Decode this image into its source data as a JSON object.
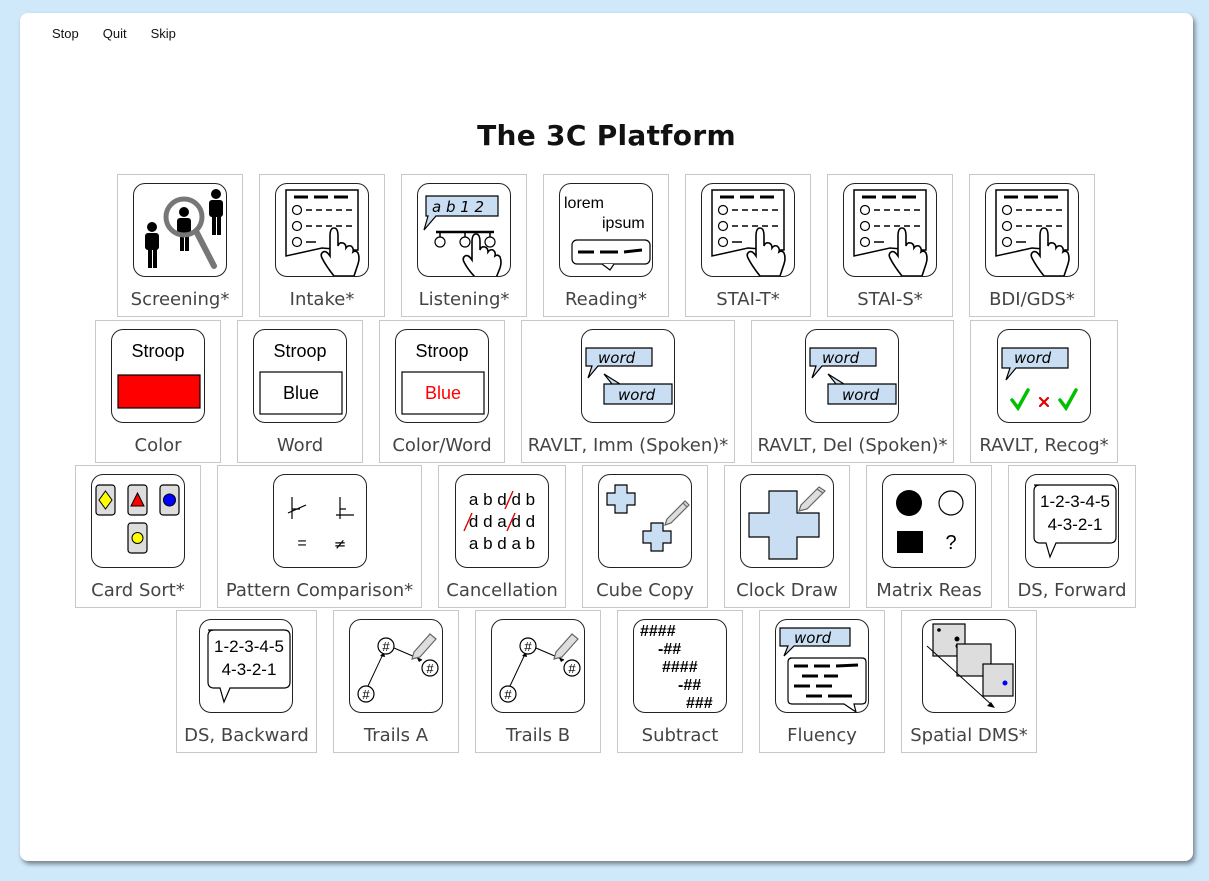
{
  "menu": {
    "stop": "Stop",
    "quit": "Quit",
    "skip": "Skip"
  },
  "title": "The 3C Platform",
  "rows": [
    [
      {
        "label": "Screening*",
        "icon": "screening-magnifier-people-icon"
      },
      {
        "label": "Intake*",
        "icon": "form-checklist-hand-icon"
      },
      {
        "label": "Listening*",
        "icon": "listening-speech-options-icon",
        "text": "a b 1 2"
      },
      {
        "label": "Reading*",
        "icon": "reading-text-icon",
        "text1": "lorem",
        "text2": "ipsum"
      },
      {
        "label": "STAI-T*",
        "icon": "form-checklist-hand-icon"
      },
      {
        "label": "STAI-S*",
        "icon": "form-checklist-hand-icon"
      },
      {
        "label": "BDI/GDS*",
        "icon": "form-checklist-hand-icon"
      }
    ],
    [
      {
        "label": "Color",
        "icon": "stroop-color-icon",
        "text1": "Stroop"
      },
      {
        "label": "Word",
        "icon": "stroop-word-icon",
        "text1": "Stroop",
        "text2": "Blue"
      },
      {
        "label": "Color/Word",
        "icon": "stroop-colorword-icon",
        "text1": "Stroop",
        "text2": "Blue"
      },
      {
        "label": "RAVLT, Imm (Spoken)*",
        "icon": "word-speech-bubbles-icon",
        "text1": "word",
        "text2": "word"
      },
      {
        "label": "RAVLT, Del (Spoken)*",
        "icon": "word-speech-bubbles-icon",
        "text1": "word",
        "text2": "word"
      },
      {
        "label": "RAVLT, Recog*",
        "icon": "word-recognition-checks-icon",
        "text1": "word"
      }
    ],
    [
      {
        "label": "Card Sort*",
        "icon": "card-sort-shapes-icon"
      },
      {
        "label": "Pattern Comparison*",
        "icon": "pattern-comparison-icon",
        "text1": "=",
        "text2": "≠"
      },
      {
        "label": "Cancellation",
        "icon": "cancellation-letters-icon",
        "lines": [
          "a b d d b",
          "d d a d d",
          "a b d a b"
        ]
      },
      {
        "label": "Cube Copy",
        "icon": "cube-copy-pencil-icon"
      },
      {
        "label": "Clock Draw",
        "icon": "clock-draw-pencil-icon"
      },
      {
        "label": "Matrix Reas",
        "icon": "matrix-reasoning-shapes-icon",
        "text1": "?"
      },
      {
        "label": "DS, Forward",
        "icon": "digit-span-speech-icon",
        "text1": "1-2-3-4-5",
        "text2": "4-3-2-1"
      }
    ],
    [
      {
        "label": "DS, Backward",
        "icon": "digit-span-speech-icon",
        "text1": "1-2-3-4-5",
        "text2": "4-3-2-1"
      },
      {
        "label": "Trails A",
        "icon": "trails-nodes-pencil-icon",
        "text1": "#"
      },
      {
        "label": "Trails B",
        "icon": "trails-nodes-pencil-icon",
        "text1": "#"
      },
      {
        "label": "Subtract",
        "icon": "subtract-hashes-icon",
        "lines": [
          "####",
          "-##",
          "####",
          "-##",
          "###"
        ]
      },
      {
        "label": "Fluency",
        "icon": "fluency-word-speech-icon",
        "text1": "word"
      },
      {
        "label": "Spatial DMS*",
        "icon": "spatial-dms-squares-icon"
      }
    ]
  ],
  "colors": {
    "background": "#cfe8fa",
    "icon_fill": "#c9def2",
    "red": "#ff0000",
    "green": "#00c000",
    "blue": "#0000ff",
    "yellow": "#ffff00"
  }
}
